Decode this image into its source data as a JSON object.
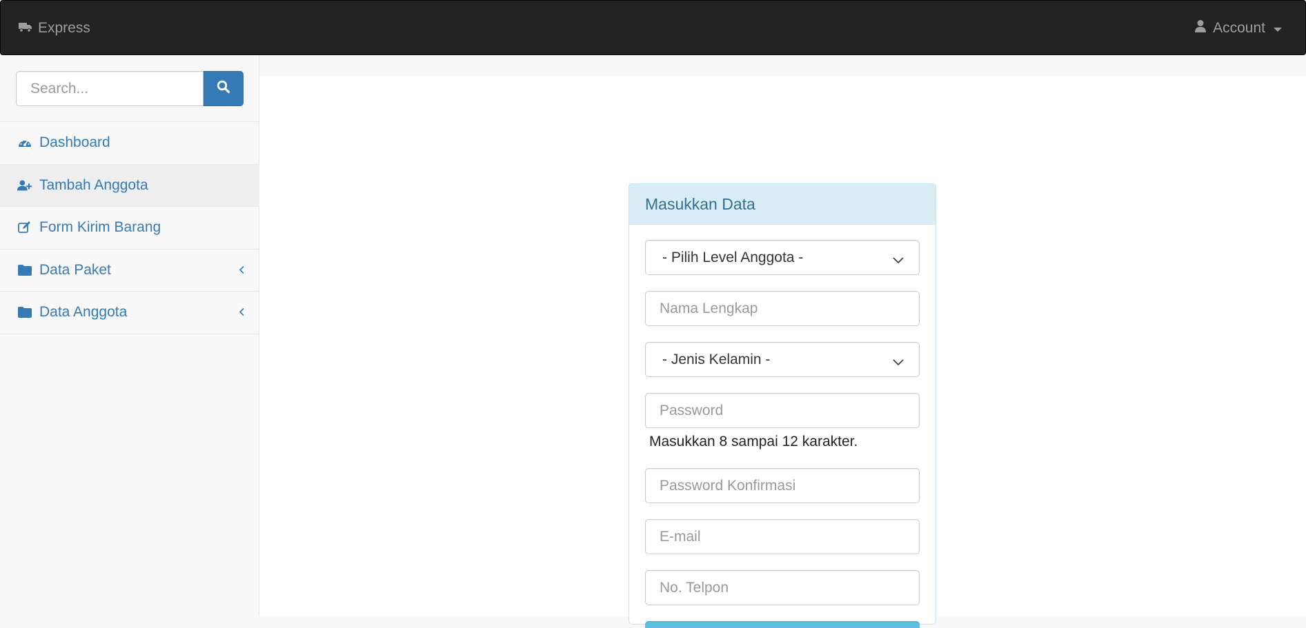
{
  "navbar": {
    "brand": "Express",
    "brand_icon": "truck-icon",
    "account_label": "Account",
    "account_icon": "user-icon"
  },
  "sidebar": {
    "search_placeholder": "Search...",
    "items": [
      {
        "label": "Dashboard",
        "icon": "dashboard-icon"
      },
      {
        "label": "Tambah Anggota",
        "icon": "user-plus-icon",
        "active": true
      },
      {
        "label": "Form Kirim Barang",
        "icon": "edit-icon"
      },
      {
        "label": "Data Paket",
        "icon": "folder-icon",
        "has_submenu": true
      },
      {
        "label": "Data Anggota",
        "icon": "folder-icon",
        "has_submenu": true
      }
    ]
  },
  "form": {
    "title": "Masukkan Data",
    "level_select": "- Pilih Level Anggota -",
    "nama_placeholder": "Nama Lengkap",
    "gender_select": "- Jenis Kelamin -",
    "password_placeholder": "Password",
    "password_help": "Masukkan 8 sampai 12 karakter.",
    "password_confirm_placeholder": "Password Konfirmasi",
    "email_placeholder": "E-mail",
    "phone_placeholder": "No. Telpon"
  },
  "colors": {
    "navbar_bg": "#222222",
    "link": "#337ab7",
    "panel_heading_bg": "#d9edf7",
    "panel_heading_text": "#31708f",
    "panel_border": "#bce8f1"
  }
}
